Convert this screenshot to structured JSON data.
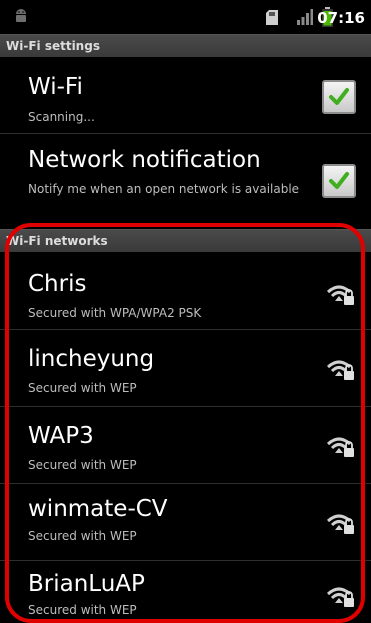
{
  "status_bar": {
    "time": "07:16"
  },
  "settings_header": "Wi-Fi settings",
  "wifi": {
    "title": "Wi-Fi",
    "summary": "Scanning..."
  },
  "notification": {
    "title": "Network notification",
    "summary": "Notify me when an open network is available"
  },
  "networks_header": "Wi-Fi networks",
  "networks": [
    {
      "ssid": "Chris",
      "security": "Secured with WPA/WPA2 PSK"
    },
    {
      "ssid": "lincheyung",
      "security": "Secured with WEP"
    },
    {
      "ssid": "WAP3",
      "security": "Secured with WEP"
    },
    {
      "ssid": "winmate-CV",
      "security": "Secured with WEP"
    },
    {
      "ssid": "BrianLuAP",
      "security": "Secured with WEP"
    }
  ],
  "colors": {
    "highlight": "#e00000",
    "check": "#3fae1f",
    "header_bg": "#3f3f3f"
  },
  "icons": {
    "status": [
      "android-icon",
      "sd-card-icon",
      "signal-icon",
      "battery-icon"
    ],
    "checkbox": "checkmark-icon",
    "network": "wifi-lock-icon"
  }
}
